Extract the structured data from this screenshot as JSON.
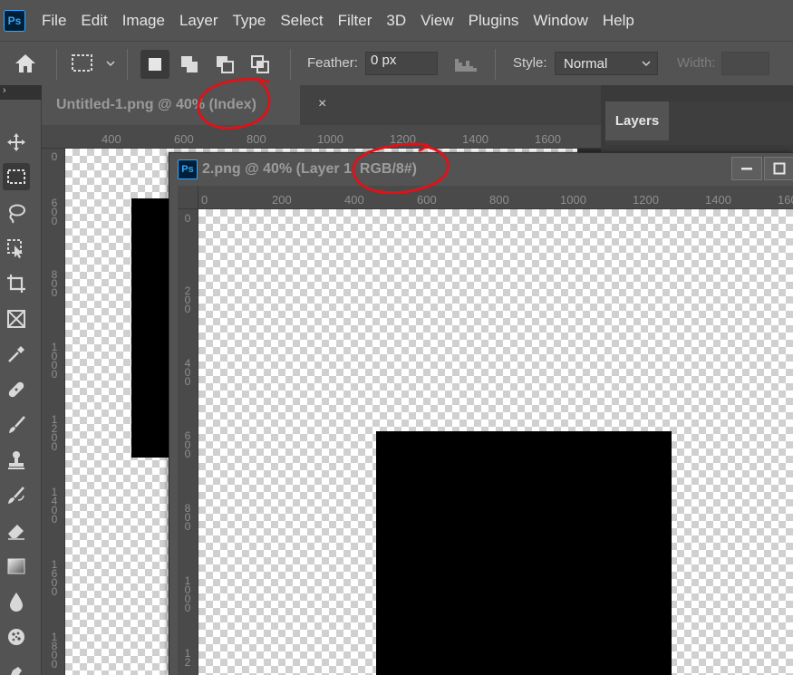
{
  "app": {
    "logo": "Ps"
  },
  "menu": [
    "File",
    "Edit",
    "Image",
    "Layer",
    "Type",
    "Select",
    "Filter",
    "3D",
    "View",
    "Plugins",
    "Window",
    "Help"
  ],
  "options": {
    "feather_label": "Feather:",
    "feather_value": "0 px",
    "style_label": "Style:",
    "style_value": "Normal",
    "width_label": "Width:",
    "width_value": ""
  },
  "toolbar": {
    "collapse_glyph": "›",
    "tools": [
      "move-icon",
      "rect-marquee-icon",
      "lasso-icon",
      "object-select-icon",
      "crop-icon",
      "frame-icon",
      "eyedropper-icon",
      "healing-icon",
      "brush-icon",
      "stamp-icon",
      "history-brush-icon",
      "eraser-icon",
      "gradient-icon",
      "blur-icon",
      "sponge-icon",
      "pen-icon"
    ]
  },
  "doc1": {
    "tab_title": "Untitled-1.png @ 40% (Index)",
    "close": "×",
    "hruler": [
      "400",
      "600",
      "800",
      "1000",
      "1200",
      "1400",
      "1600"
    ],
    "vruler": [
      "0",
      "6 0 0",
      "8 0 0",
      "1 0 0 0",
      "1 2 0 0",
      "1 4 0 0",
      "1 6 0 0",
      "1 8 0 0"
    ]
  },
  "panels": {
    "layers_tab": "Layers"
  },
  "doc2": {
    "ps_icon": "Ps",
    "title": "2.png @ 40% (Layer 1, RGB/8#)",
    "hruler": [
      "0",
      "200",
      "400",
      "600",
      "800",
      "1000",
      "1200",
      "1400",
      "160"
    ],
    "vruler": [
      "0",
      "2 0 0",
      "4 0 0",
      "6 0 0",
      "8 0 0",
      "1 0 0 0",
      "1 2"
    ]
  },
  "colors": {
    "annotation": "#d8151b",
    "panel": "#535353",
    "ruler": "#4a4a4a"
  }
}
